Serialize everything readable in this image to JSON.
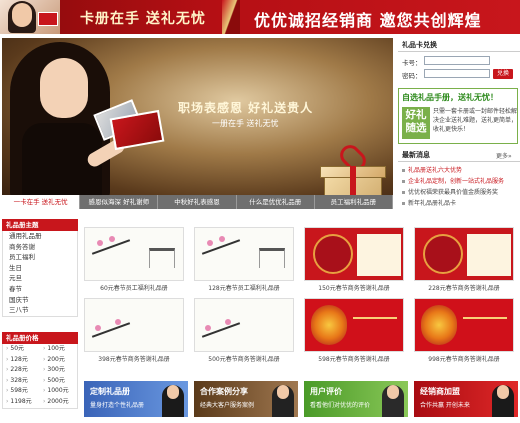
{
  "top_banner": {
    "slogan_left": "卡册在手 送礼无忧",
    "slogan_right": "优优诚招经销商  邀您共创辉煌"
  },
  "hero": {
    "headline": "职场表感恩 好礼送贵人",
    "sub": "一册在手 送礼无忧",
    "tabs": [
      "一卡在手 送礼无忧",
      "感恩似海深 好礼谢师",
      "中秋好礼表感恩",
      "什么是优优礼品册",
      "员工福利礼品册"
    ],
    "active_tab": 0
  },
  "redeem": {
    "title": "礼品卡兑换",
    "card_label": "卡号：",
    "password_label": "密码：",
    "card_value": "",
    "password_value": "",
    "button": "兑换"
  },
  "promo": {
    "title": "自选礼品手册，送礼无忧！",
    "badge": "好礼随选",
    "desc": "只需一套卡册或一封邮件轻松解决企业送礼难题，送礼更简单，收礼更快乐！"
  },
  "news": {
    "title": "最新消息",
    "more": "更多»",
    "items": [
      {
        "text": "礼品册送礼六大优势",
        "hot": true
      },
      {
        "text": "企业礼品定制，创新一站式礼品服务",
        "hot": true
      },
      {
        "text": "优优祝福荣获最具价值金质服务奖",
        "hot": false
      },
      {
        "text": "新年礼品册礼品卡",
        "hot": false
      }
    ]
  },
  "sidebar": {
    "theme_title": "礼品册主题",
    "themes": [
      "通用礼品册",
      "商务答谢",
      "员工福利",
      "生日",
      "元旦",
      "春节",
      "国庆节",
      "三八节"
    ],
    "price_title": "礼品册价格",
    "prices": [
      "50元",
      "100元",
      "128元",
      "200元",
      "228元",
      "300元",
      "328元",
      "500元",
      "598元",
      "1000元",
      "1198元",
      "2000元"
    ]
  },
  "products": [
    {
      "caption": "60元春节员工福利礼品册",
      "style": "ink"
    },
    {
      "caption": "128元春节员工福利礼品册",
      "style": "ink"
    },
    {
      "caption": "150元春节商务答谢礼品册",
      "style": "red"
    },
    {
      "caption": "228元春节商务答谢礼品册",
      "style": "red"
    },
    {
      "caption": "398元春节商务答谢礼品册",
      "style": "ink"
    },
    {
      "caption": "500元春节商务答谢礼品册",
      "style": "ink"
    },
    {
      "caption": "598元春节商务答谢礼品册",
      "style": "red2"
    },
    {
      "caption": "998元春节商务答谢礼品册",
      "style": "red2"
    }
  ],
  "bottom_banners": [
    {
      "title": "定制礼品册",
      "sub": "量身打造个性礼品册",
      "color": "#4a78c8"
    },
    {
      "title": "合作案例分享",
      "sub": "经典大客户服务案例",
      "color": "#7a5a3a"
    },
    {
      "title": "用户评价",
      "sub": "看看他们对优优的评价",
      "color": "#6aa83a"
    },
    {
      "title": "经销商加盟",
      "sub": "合作共赢 开创未来",
      "color": "#c8161c"
    }
  ],
  "colors": {
    "brand_red": "#c8161c",
    "promo_green": "#2d8a1c"
  }
}
